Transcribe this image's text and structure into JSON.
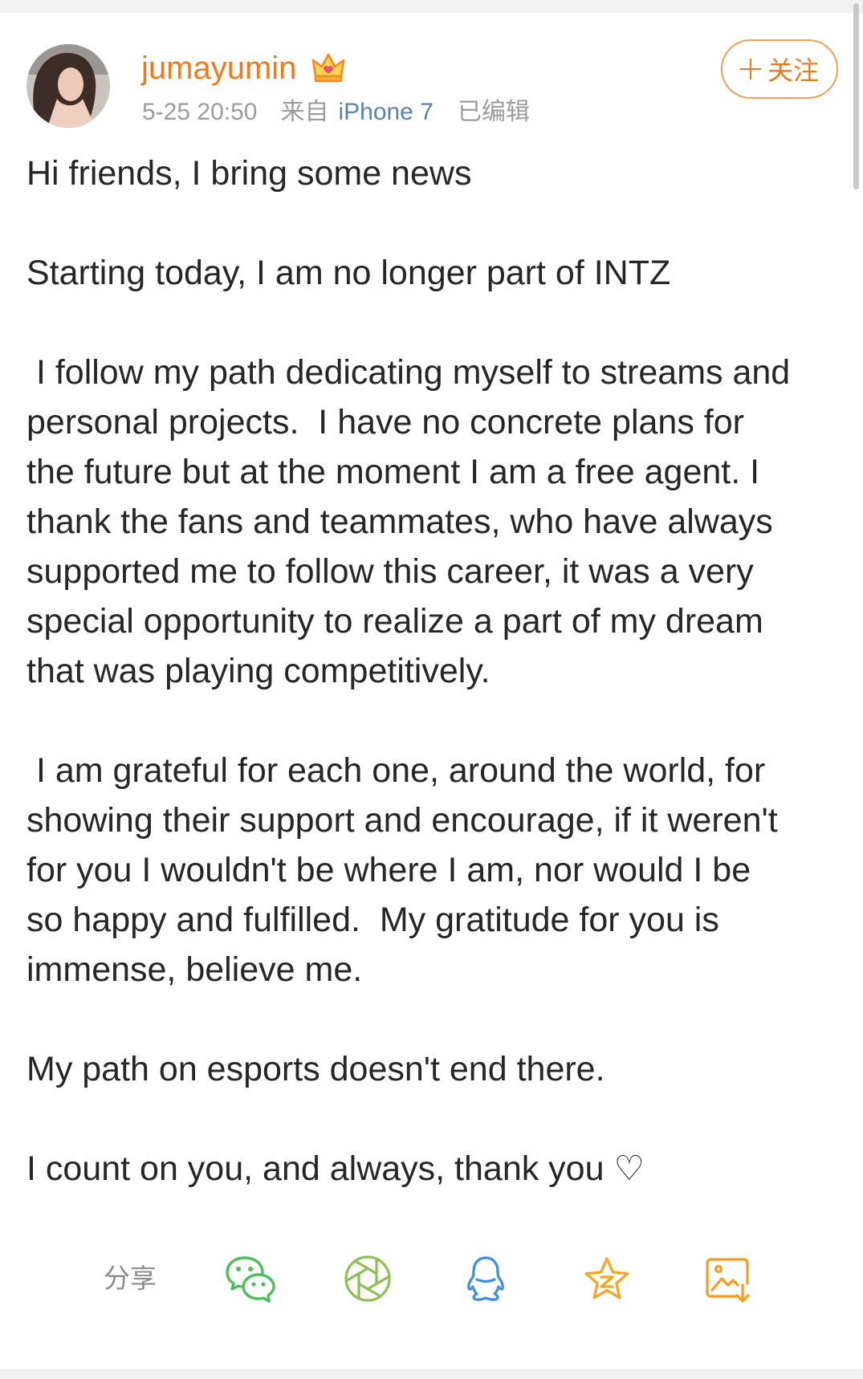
{
  "post": {
    "author": {
      "username": "jumayumin",
      "badge_icon": "crown-icon"
    },
    "meta": {
      "time": "5-25 20:50",
      "source_prefix": "来自",
      "source_device": "iPhone 7",
      "edited": "已编辑"
    },
    "follow_button": {
      "icon": "plus-icon",
      "label": "关注"
    },
    "body": {
      "paragraphs": [
        {
          "lines": [
            "Hi friends, I bring some news"
          ]
        },
        {
          "lines": [
            "Starting today, I am no longer part of INTZ"
          ]
        },
        {
          "lines": [
            " I follow my path dedicating myself to streams and",
            "personal projects.  I have no concrete plans for",
            "the future but at the moment I am a free agent. I",
            "thank the fans and teammates, who have always",
            "supported me to follow this career, it was a very",
            "special opportunity to realize a part of my dream",
            "that was playing competitively."
          ]
        },
        {
          "lines": [
            " I am grateful for each one, around the world, for",
            "showing their support and encourage, if it weren't",
            "for you I wouldn't be where I am, nor would I be",
            "so happy and fulfilled.  My gratitude for you is",
            "immense, believe me."
          ]
        },
        {
          "lines": [
            "My path on esports doesn't end there."
          ]
        },
        {
          "lines": [
            "I count on you, and always, thank you ♡"
          ]
        }
      ]
    }
  },
  "share": {
    "label": "分享",
    "targets": [
      {
        "icon": "wechat-icon",
        "color": "#4cbf59"
      },
      {
        "icon": "moments-icon",
        "color": "#8cc152"
      },
      {
        "icon": "qq-icon",
        "color": "#3a8ee6"
      },
      {
        "icon": "qzone-icon",
        "color": "#f7a51c"
      },
      {
        "icon": "save-image-icon",
        "color": "#f39c1e"
      }
    ]
  },
  "colors": {
    "accent": "#f07a1a",
    "follow_border": "#f1a058",
    "link": "#5a81b4",
    "meta_text": "#9b9b9b",
    "body_text": "#262626",
    "share_label": "#8c8c8c"
  }
}
